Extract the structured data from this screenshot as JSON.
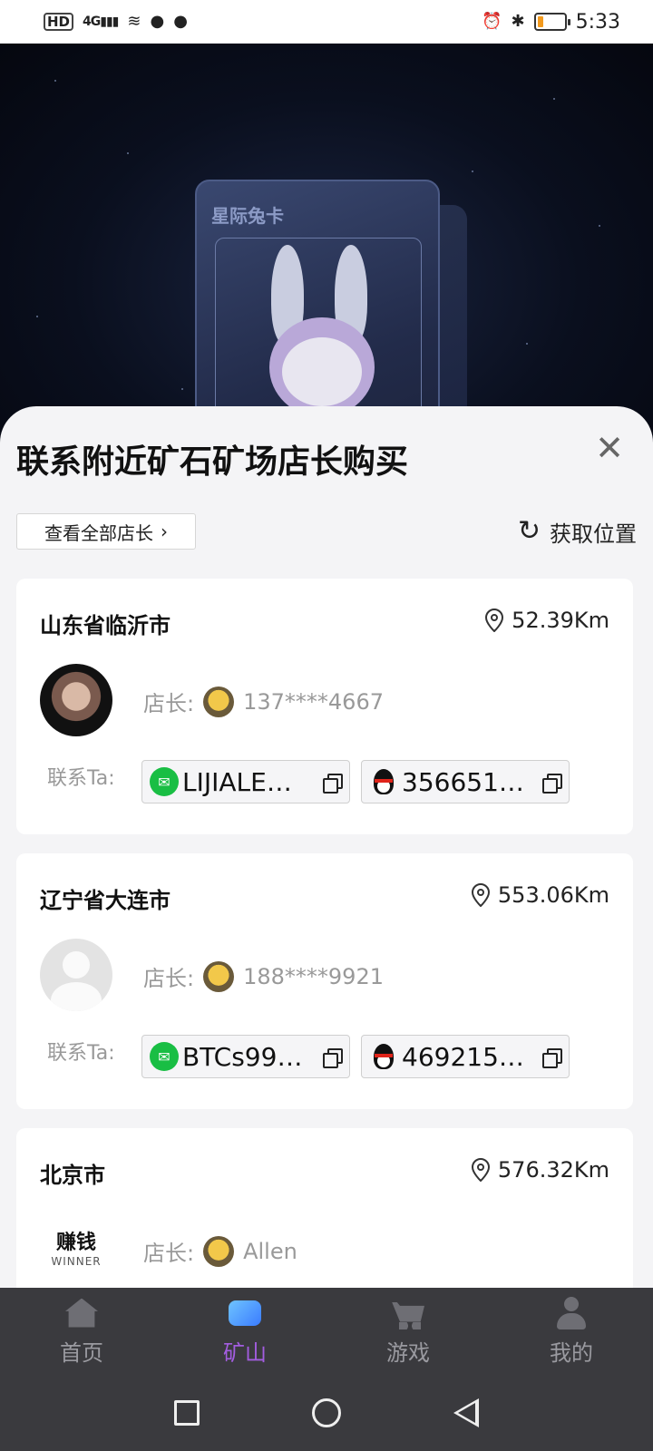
{
  "status_bar": {
    "hd": "HD",
    "signal": "4G",
    "time": "5:33"
  },
  "hero": {
    "card_text": "星际兔卡"
  },
  "sheet": {
    "title": "联系附近矿石矿场店长购买",
    "view_all_label": "查看全部店长",
    "get_location_label": "获取位置"
  },
  "labels": {
    "owner_prefix": "店长:",
    "contact_prefix": "联系Ta:"
  },
  "shops": [
    {
      "city": "山东省临沂市",
      "distance": "52.39Km",
      "owner": "137****4667",
      "wechat": "LIJIALE…",
      "qq": "356651…"
    },
    {
      "city": "辽宁省大连市",
      "distance": "553.06Km",
      "owner": "188****9921",
      "wechat": "BTCs99…",
      "qq": "469215…"
    },
    {
      "city": "北京市",
      "distance": "576.32Km",
      "owner": "Allen",
      "avatar_brand": "赚钱",
      "avatar_brand_sub": "WINNER"
    }
  ],
  "tabs": [
    {
      "label": "首页",
      "icon": "home-icon",
      "active": false
    },
    {
      "label": "矿山",
      "icon": "mine-icon",
      "active": true
    },
    {
      "label": "游戏",
      "icon": "cart-icon",
      "active": false
    },
    {
      "label": "我的",
      "icon": "profile-icon",
      "active": false
    }
  ],
  "colors": {
    "active_tab": "#a35de0",
    "wechat_green": "#19be44",
    "battery_level": "#f39a1d"
  }
}
